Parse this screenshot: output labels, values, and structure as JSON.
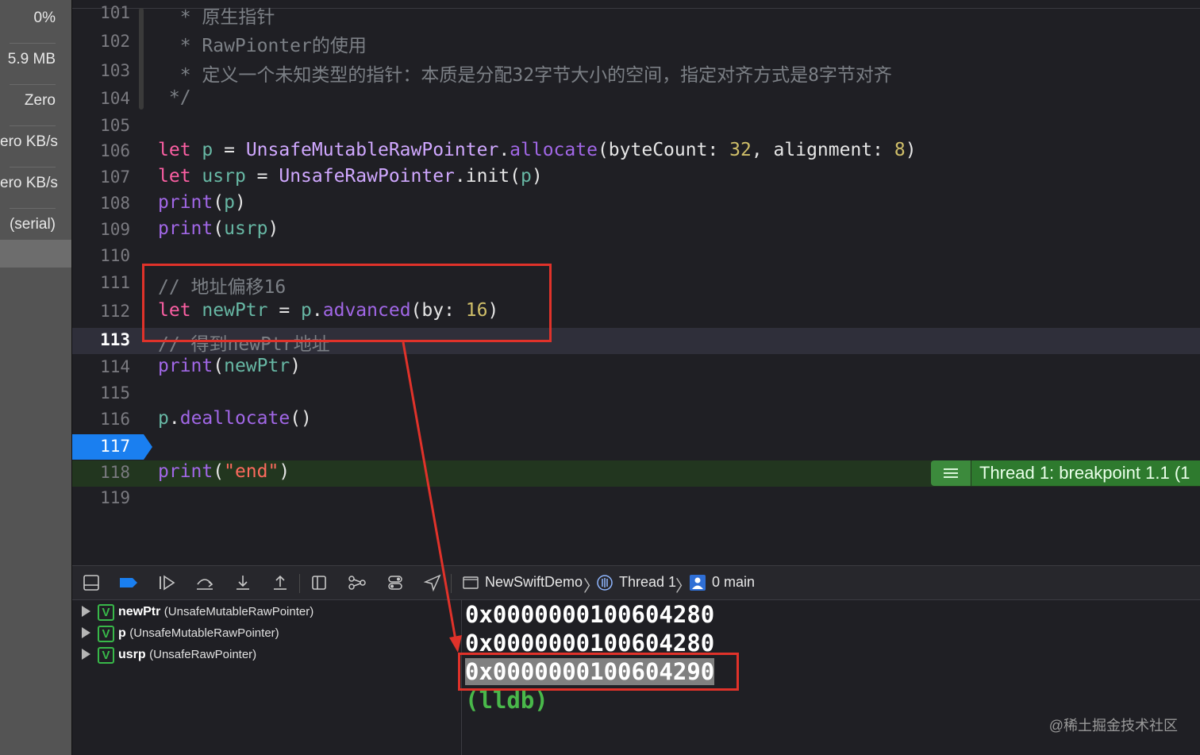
{
  "gauges": [
    "0%",
    "5.9 MB",
    "Zero",
    "ero KB/s",
    "ero KB/s",
    "(serial)"
  ],
  "editor": {
    "lines": [
      {
        "n": "101",
        "text": "  * 原生指针"
      },
      {
        "n": "102",
        "text": "  * RawPionter的使用"
      },
      {
        "n": "103",
        "text": "  * 定义一个未知类型的指针：本质是分配32字节大小的空间，指定对齐方式是8字节对齐"
      },
      {
        "n": "104",
        "text": " */"
      },
      {
        "n": "105",
        "text": ""
      },
      {
        "n": "106",
        "parts": [
          "let",
          " ",
          "p",
          " = ",
          "UnsafeMutableRawPointer",
          ".",
          "allocate",
          "(byteCount: ",
          "32",
          ", alignment: ",
          "8",
          ")"
        ]
      },
      {
        "n": "107",
        "parts": [
          "let",
          " ",
          "usrp",
          " = ",
          "UnsafeRawPointer",
          ".init(",
          "p",
          ")"
        ]
      },
      {
        "n": "108",
        "parts": [
          "print",
          "(",
          "p",
          ")"
        ]
      },
      {
        "n": "109",
        "parts": [
          "print",
          "(",
          "usrp",
          ")"
        ]
      },
      {
        "n": "110",
        "text": ""
      },
      {
        "n": "111",
        "text": "// 地址偏移16"
      },
      {
        "n": "112",
        "parts": [
          "let",
          " ",
          "newPtr",
          " = ",
          "p",
          ".",
          "advanced",
          "(by: ",
          "16",
          ")"
        ]
      },
      {
        "n": "113",
        "text": "// 得到newPtr地址"
      },
      {
        "n": "114",
        "parts": [
          "print",
          "(",
          "newPtr",
          ")"
        ]
      },
      {
        "n": "115",
        "text": ""
      },
      {
        "n": "116",
        "parts": [
          "p",
          ".",
          "deallocate",
          "()"
        ]
      },
      {
        "n": "117",
        "text": ""
      },
      {
        "n": "118",
        "parts": [
          "print",
          "(",
          "\"end\"",
          ")"
        ]
      },
      {
        "n": "119",
        "text": ""
      }
    ],
    "thread_badge": "Thread 1: breakpoint 1.1 (1"
  },
  "debug_bar": {
    "breadcrumbs": [
      "NewSwiftDemo",
      "Thread 1",
      "0 main"
    ]
  },
  "variables": [
    {
      "name": "newPtr",
      "type": "(UnsafeMutableRawPointer)"
    },
    {
      "name": "p",
      "type": "(UnsafeMutableRawPointer)"
    },
    {
      "name": "usrp",
      "type": "(UnsafeRawPointer)"
    }
  ],
  "console": {
    "outputs": [
      "0x0000000100604280",
      "0x0000000100604280",
      "0x0000000100604290"
    ],
    "prompt": "(lldb)"
  },
  "watermark": "@稀土掘金技术社区",
  "colors": {
    "keyword": "#fc5fa3",
    "function": "#a167e6",
    "variable": "#67b7a4",
    "number": "#d0bf69",
    "comment": "#7c8086",
    "annotation": "#e0322a",
    "breakpoint": "#1a7ff0"
  }
}
